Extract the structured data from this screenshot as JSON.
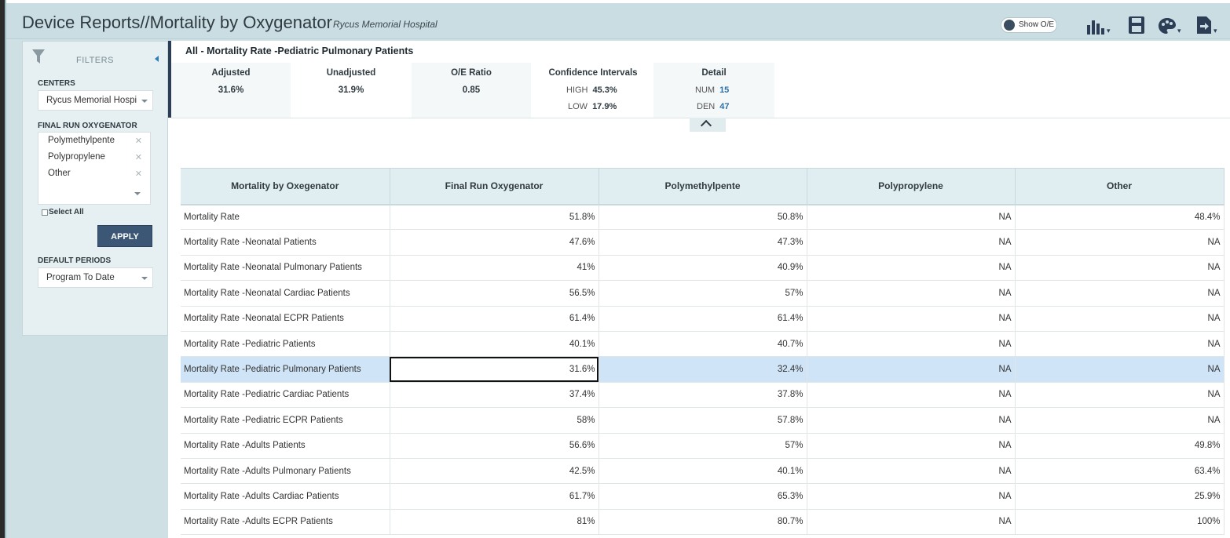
{
  "header": {
    "title": "Device Reports//Mortality by Oxygenator",
    "subtitle": "Rycus Memorial Hospital",
    "show_oe_label": "Show O/E"
  },
  "toolbar": {
    "chart_icon": "bar-chart-icon",
    "save_icon": "save-icon",
    "palette_icon": "palette-icon",
    "export_icon": "export-icon"
  },
  "sidebar": {
    "filters_label": "FILTERS",
    "centers_label": "CENTERS",
    "centers_value": "Rycus Memorial Hospi",
    "oxygenator_label": "FINAL RUN OXYGENATOR",
    "oxygenator_selected": [
      "Polymethylpente",
      "Polypropylene",
      "Other"
    ],
    "select_all_label": "Select All",
    "apply_label": "APPLY",
    "periods_label": "DEFAULT PERIODS",
    "periods_value": "Program To Date"
  },
  "summary": {
    "title": "All - Mortality Rate -Pediatric Pulmonary Patients",
    "adjusted_label": "Adjusted",
    "adjusted_value": "31.6%",
    "unadjusted_label": "Unadjusted",
    "unadjusted_value": "31.9%",
    "oe_label": "O/E Ratio",
    "oe_value": "0.85",
    "ci_label": "Confidence Intervals",
    "ci_high_label": "HIGH",
    "ci_high_value": "45.3%",
    "ci_low_label": "LOW",
    "ci_low_value": "17.9%",
    "detail_label": "Detail",
    "num_label": "NUM",
    "num_value": "15",
    "den_label": "DEN",
    "den_value": "47"
  },
  "table": {
    "headers": [
      "Mortality by Oxegenator",
      "Final Run Oxygenator",
      "Polymethylpente",
      "Polypropylene",
      "Other"
    ],
    "selected_row": 6,
    "rows": [
      [
        "Mortality Rate",
        "51.8%",
        "50.8%",
        "NA",
        "48.4%"
      ],
      [
        "Mortality Rate -Neonatal Patients",
        "47.6%",
        "47.3%",
        "NA",
        "NA"
      ],
      [
        "Mortality Rate -Neonatal Pulmonary Patients",
        "41%",
        "40.9%",
        "NA",
        "NA"
      ],
      [
        "Mortality Rate -Neonatal Cardiac Patients",
        "56.5%",
        "57%",
        "NA",
        "NA"
      ],
      [
        "Mortality Rate -Neonatal ECPR Patients",
        "61.4%",
        "61.4%",
        "NA",
        "NA"
      ],
      [
        "Mortality Rate -Pediatric Patients",
        "40.1%",
        "40.7%",
        "NA",
        "NA"
      ],
      [
        "Mortality Rate -Pediatric Pulmonary Patients",
        "31.6%",
        "32.4%",
        "NA",
        "NA"
      ],
      [
        "Mortality Rate -Pediatric Cardiac Patients",
        "37.4%",
        "37.8%",
        "NA",
        "NA"
      ],
      [
        "Mortality Rate -Pediatric ECPR Patients",
        "58%",
        "57.8%",
        "NA",
        "NA"
      ],
      [
        "Mortality Rate -Adults Patients",
        "56.6%",
        "57%",
        "NA",
        "49.8%"
      ],
      [
        "Mortality Rate -Adults Pulmonary Patients",
        "42.5%",
        "40.1%",
        "NA",
        "63.4%"
      ],
      [
        "Mortality Rate -Adults Cardiac Patients",
        "61.7%",
        "65.3%",
        "NA",
        "25.9%"
      ],
      [
        "Mortality Rate -Adults ECPR Patients",
        "81%",
        "80.7%",
        "NA",
        "100%"
      ]
    ]
  }
}
